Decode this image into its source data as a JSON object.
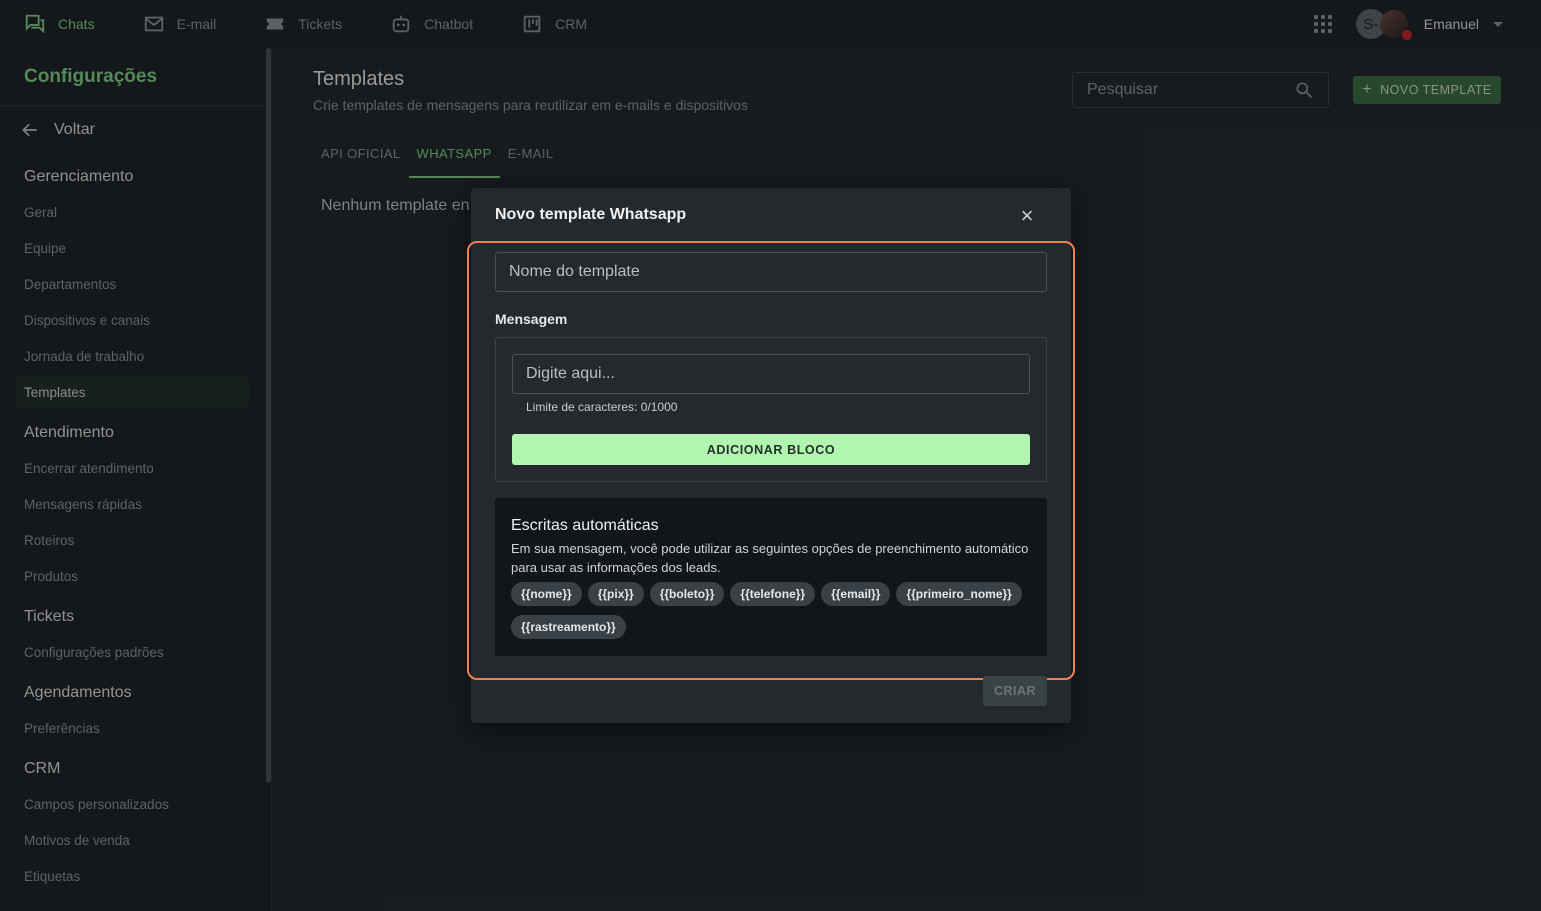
{
  "topnav": {
    "items": [
      {
        "label": "Chats",
        "icon": "chat-bubbles-icon",
        "active": true
      },
      {
        "label": "E-mail",
        "icon": "mail-icon",
        "active": false
      },
      {
        "label": "Tickets",
        "icon": "ticket-icon",
        "active": false
      },
      {
        "label": "Chatbot",
        "icon": "robot-icon",
        "active": false
      },
      {
        "label": "CRM",
        "icon": "kanban-icon",
        "active": false
      }
    ],
    "avatar_letter": "S-",
    "username": "Emanuel"
  },
  "sidebar": {
    "title": "Configurações",
    "back_label": "Voltar",
    "sections": [
      {
        "heading": "Gerenciamento",
        "items": [
          "Geral",
          "Equipe",
          "Departamentos",
          "Dispositivos e canais",
          "Jornada de trabalho",
          "Templates"
        ]
      },
      {
        "heading": "Atendimento",
        "items": [
          "Encerrar atendimento",
          "Mensagens rápidas",
          "Roteiros",
          "Produtos"
        ]
      },
      {
        "heading": "Tickets",
        "items": [
          "Configurações padrões"
        ]
      },
      {
        "heading": "Agendamentos",
        "items": [
          "Preferências"
        ]
      },
      {
        "heading": "CRM",
        "items": [
          "Campos personalizados",
          "Motivos de venda",
          "Etiquetas"
        ]
      }
    ],
    "active_item": "Templates"
  },
  "main": {
    "title": "Templates",
    "subtitle": "Crie templates de mensagens para reutilizar em e-mails e dispositivos",
    "search_placeholder": "Pesquisar",
    "new_button": "NOVO TEMPLATE",
    "tabs": [
      "API OFICIAL",
      "WHATSAPP",
      "E-MAIL"
    ],
    "active_tab": "WHATSAPP",
    "empty_message": "Nenhum template en"
  },
  "modal": {
    "title": "Novo template Whatsapp",
    "name_placeholder": "Nome do template",
    "message_label": "Mensagem",
    "message_placeholder": "Digite aqui...",
    "char_limit": "Limite de caracteres: 0/1000",
    "add_block": "ADICIONAR BLOCO",
    "auto_title": "Escritas automáticas",
    "auto_desc": "Em sua mensagem, você pode utilizar as seguintes opções de preenchimento automático para usar as informações dos leads.",
    "variables": [
      "{{nome}}",
      "{{pix}}",
      "{{boleto}}",
      "{{telefone}}",
      "{{email}}",
      "{{primeiro_nome}}",
      "{{rastreamento}}"
    ],
    "create_button": "CRIAR"
  },
  "colors": {
    "accent": "#7ec987",
    "highlight": "#f08050",
    "add_block_bg": "#b2f5b0"
  }
}
